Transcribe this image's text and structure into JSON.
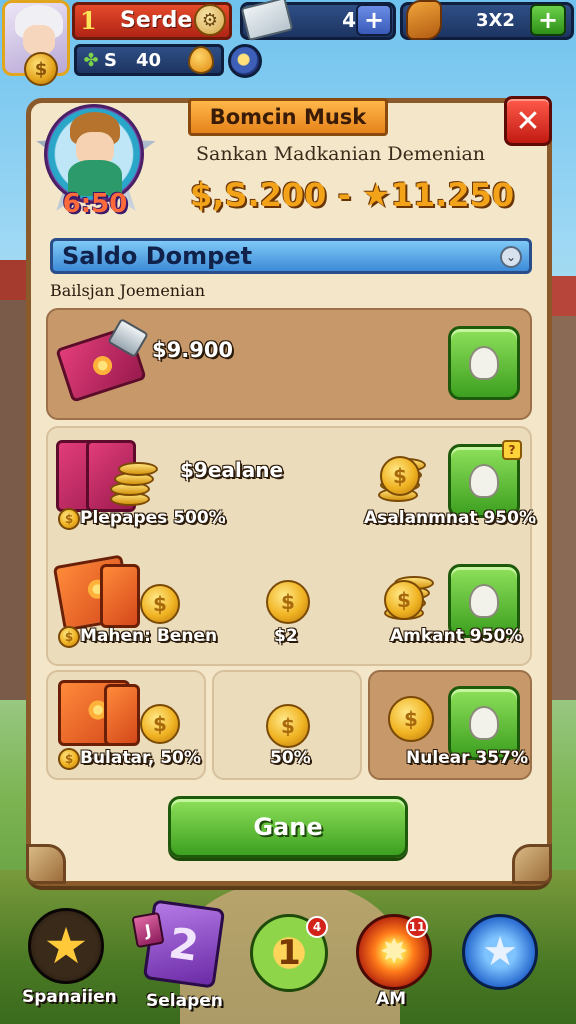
{
  "hud": {
    "level": "1",
    "player_name": "Serde",
    "money_currency": "S",
    "money_value": "40",
    "cash_value": "4",
    "cash_plus": "+",
    "gem_value": "3X2",
    "gem_plus": "+"
  },
  "panel": {
    "hero_timer": "6:50",
    "title": "Bomcin Musk",
    "subtitle": "Sankan Madkanian Demenian",
    "price_range": "$,S.200 - ★11.250",
    "close_label": "✕",
    "section_title": "Saldo Dompet",
    "section_subtitle": "Bailsjan Joemenian",
    "offers": {
      "top": {
        "amount": "$9.900"
      },
      "mid_header": "$9ealane",
      "item1": {
        "label": "Plepapes 500%"
      },
      "item2": {
        "label": "Asalanmnat 950%"
      },
      "item3": {
        "label": "Mahen: Benen"
      },
      "item4": {
        "label": "$2"
      },
      "item5": {
        "label": "Amkant 950%"
      },
      "item6": {
        "label": "Bulatar, 50%"
      },
      "item7": {
        "label": "50%"
      },
      "item8": {
        "label": "Nulear 357%"
      }
    },
    "badge": "?",
    "primary_button": "Gane"
  },
  "nav": {
    "items": [
      {
        "label": "Spanaiien",
        "icon": "star-icon"
      },
      {
        "label": "Selapen",
        "icon": "cards-icon",
        "small_glyph": "J",
        "big_glyph": "2"
      },
      {
        "label": "",
        "icon": "box-icon",
        "badge": "4",
        "glyph": "1"
      },
      {
        "label": "AM",
        "icon": "fire-icon",
        "badge": "11"
      },
      {
        "label": "",
        "icon": "blue-star-icon"
      }
    ]
  },
  "colors": {
    "panel_bg": "#f4e6c8",
    "panel_border": "#8b5a2b",
    "accent_green": "#3da020",
    "accent_red": "#c21a12",
    "section_blue": "#3d8ad8",
    "gold": "#f2a31a"
  }
}
